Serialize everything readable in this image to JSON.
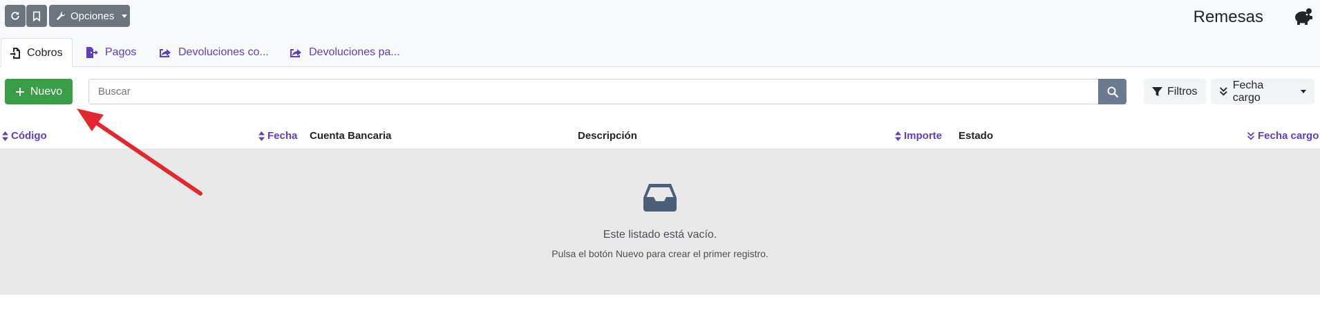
{
  "header": {
    "options_label": "Opciones",
    "title": "Remesas"
  },
  "tabs": [
    {
      "label": "Cobros",
      "active": true
    },
    {
      "label": "Pagos",
      "active": false
    },
    {
      "label": "Devoluciones co...",
      "active": false
    },
    {
      "label": "Devoluciones pa...",
      "active": false
    }
  ],
  "toolbar": {
    "new_label": "Nuevo",
    "search_placeholder": "Buscar",
    "filters_label": "Filtros",
    "sort_label": "Fecha cargo"
  },
  "table": {
    "columns": [
      {
        "label": "Código",
        "sortable": true
      },
      {
        "label": "Fecha",
        "sortable": true
      },
      {
        "label": "Cuenta Bancaria",
        "sortable": false
      },
      {
        "label": "Descripción",
        "sortable": false
      },
      {
        "label": "Importe",
        "sortable": true
      },
      {
        "label": "Estado",
        "sortable": false
      },
      {
        "label": "Fecha cargo",
        "sortable": true,
        "sorted": "desc"
      }
    ]
  },
  "empty_state": {
    "icon": "inbox-icon",
    "title": "Este listado está vacío.",
    "subtitle": "Pulsa el botón Nuevo para crear el primer registro."
  },
  "colors": {
    "primary_link": "#5f3dc4",
    "new_button": "#3a9d47",
    "secondary_button": "#6c757d",
    "annotation_arrow": "#e0282e"
  }
}
